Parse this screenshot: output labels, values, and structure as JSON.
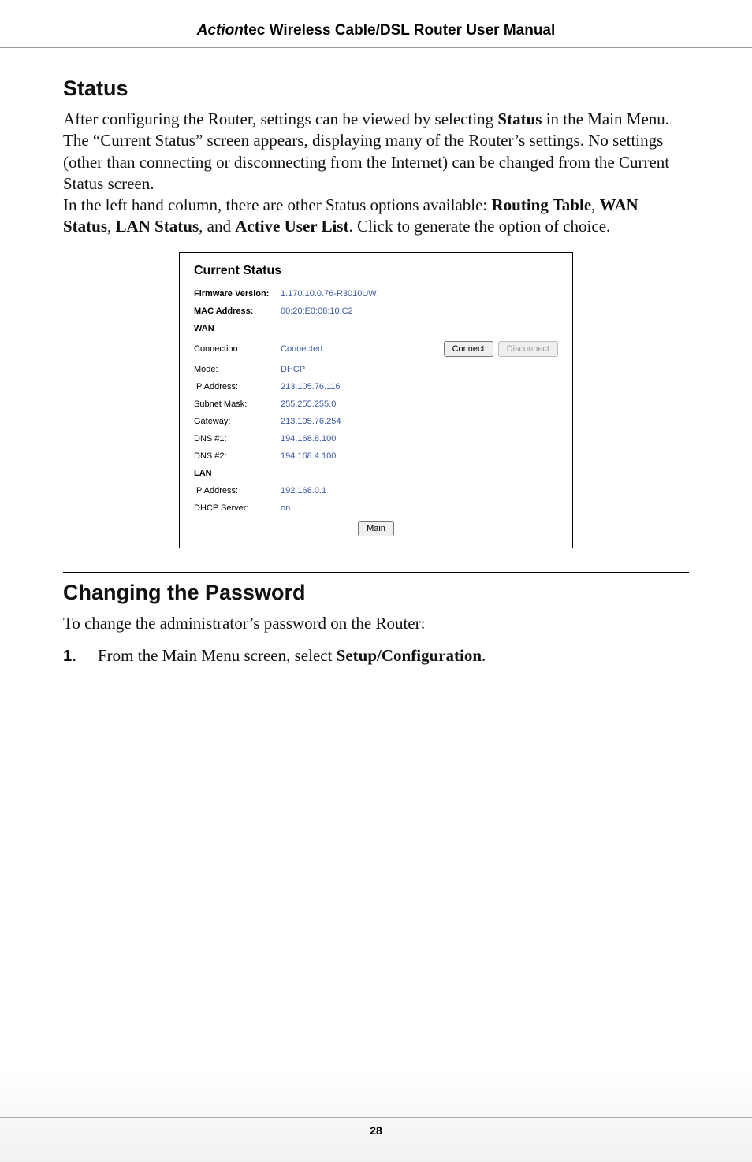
{
  "header": {
    "brand": "Action",
    "brand_suffix": "tec",
    "title_rest": " Wireless Cable/DSL Router User Manual"
  },
  "status_section": {
    "heading": "Status",
    "para1_a": "After configuring the Router, settings can be viewed by selecting ",
    "para1_bold1": "Status",
    "para1_b": " in the Main Menu. The “Current Status” screen appears, displaying many of the Router’s settings. No settings (other than connecting or disconnecting from the Internet) can be changed from the Current Status screen.",
    "para2_a": "In the left hand column, there are other Status options available: ",
    "para2_bold1": "Routing Table",
    "para2_b": ", ",
    "para2_bold2": "WAN Status",
    "para2_c": ", ",
    "para2_bold3": "LAN Status",
    "para2_d": ", and ",
    "para2_bold4": "Active User List",
    "para2_e": ". Click to generate the option of choice."
  },
  "screenshot": {
    "title": "Current Status",
    "firmware_label": "Firmware Version:",
    "firmware_value": "1.170.10.0.76-R3010UW",
    "mac_label": "MAC Address:",
    "mac_value": "00:20:E0:08:10:C2",
    "wan_header": "WAN",
    "connection_label": "Connection:",
    "connection_value": "Connected",
    "connect_btn": "Connect",
    "disconnect_btn": "Disconnect",
    "mode_label": "Mode:",
    "mode_value": "DHCP",
    "wan_ip_label": "IP Address:",
    "wan_ip_value": "213.105.76.116",
    "subnet_label": "Subnet Mask:",
    "subnet_value": "255.255.255.0",
    "gateway_label": "Gateway:",
    "gateway_value": "213.105.76.254",
    "dns1_label": "DNS #1:",
    "dns1_value": "194.168.8.100",
    "dns2_label": "DNS #2:",
    "dns2_value": "194.168.4.100",
    "lan_header": "LAN",
    "lan_ip_label": "IP Address:",
    "lan_ip_value": "192.168.0.1",
    "dhcp_server_label": "DHCP Server:",
    "dhcp_server_value": "on",
    "main_btn": "Main"
  },
  "password_section": {
    "heading": "Changing the Password",
    "intro": "To change the administrator’s password on the Router:",
    "step1_num": "1.",
    "step1_a": "From the Main Menu screen, select ",
    "step1_bold": "Setup/Configuration",
    "step1_b": "."
  },
  "footer": {
    "page_num": "28"
  }
}
